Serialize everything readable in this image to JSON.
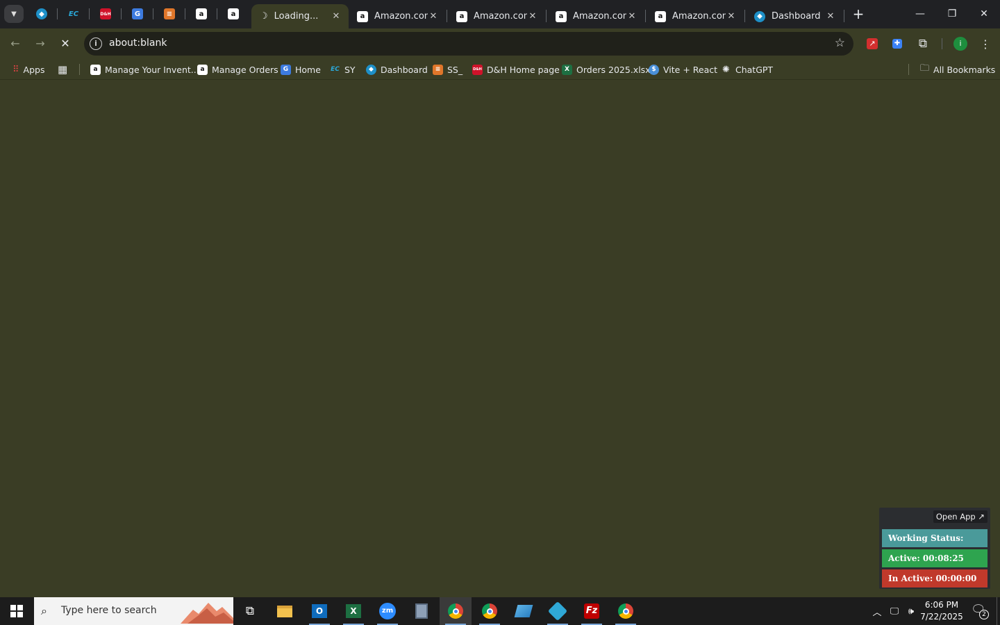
{
  "tabs": {
    "pinned": [
      {
        "icon": "dashboard-favicon",
        "color": "#4fa3e0",
        "glyph": "◆"
      },
      {
        "icon": "ec-favicon",
        "color": "#2aa8d8",
        "glyph": "EC"
      },
      {
        "icon": "dh-favicon",
        "color": "#d0122a",
        "glyph": "D&H"
      },
      {
        "icon": "google-docs-favicon",
        "color": "#3d7be0",
        "glyph": "G"
      },
      {
        "icon": "stack-favicon",
        "color": "#e0762a",
        "glyph": "≡"
      },
      {
        "icon": "amazon-favicon",
        "color": "#ffffff",
        "glyph": "a"
      },
      {
        "icon": "amazon-favicon",
        "color": "#ffffff",
        "glyph": "a"
      }
    ],
    "open": [
      {
        "title": "Loading...",
        "icon": "loading-spinner-icon",
        "active": true
      },
      {
        "title": "Amazon.com",
        "icon": "amazon-favicon",
        "active": false
      },
      {
        "title": "Amazon.com",
        "icon": "amazon-favicon",
        "active": false
      },
      {
        "title": "Amazon.com",
        "icon": "amazon-favicon",
        "active": false
      },
      {
        "title": "Amazon.com",
        "icon": "amazon-favicon",
        "active": false
      },
      {
        "title": "Dashboard",
        "icon": "dashboard-favicon",
        "active": false
      }
    ],
    "close_glyph": "✕",
    "new_tab_glyph": "+"
  },
  "window_controls": {
    "minimize": "—",
    "restore": "❐",
    "close": "✕"
  },
  "toolbar": {
    "url": "about:blank",
    "info_glyph": "i",
    "back_glyph": "←",
    "forward_glyph": "→",
    "stop_glyph": "✕",
    "star_glyph": "☆",
    "profile_initial": "i",
    "menu_glyph": "⋮"
  },
  "bookmarks": [
    {
      "label": "Apps",
      "icon": "apps-grid-icon"
    },
    {
      "label": "",
      "icon": "tab-groups-icon"
    },
    {
      "label": "Manage Your Invent...",
      "icon": "amazon-favicon"
    },
    {
      "label": "Manage Orders",
      "icon": "amazon-favicon"
    },
    {
      "label": "Home",
      "icon": "google-docs-favicon"
    },
    {
      "label": "SY",
      "icon": "ec-favicon"
    },
    {
      "label": "Dashboard",
      "icon": "dashboard-favicon"
    },
    {
      "label": "SS_",
      "icon": "stack-favicon"
    },
    {
      "label": "D&H Home page",
      "icon": "dh-favicon"
    },
    {
      "label": "Orders 2025.xlsx",
      "icon": "excel-favicon"
    },
    {
      "label": "Vite + React",
      "icon": "vite-favicon"
    },
    {
      "label": "ChatGPT",
      "icon": "chatgpt-favicon"
    },
    {
      "label": "All Bookmarks",
      "icon": "folder-icon"
    }
  ],
  "status_widget": {
    "open_app": "Open App ↗",
    "working_status": "Working Status: Active",
    "active": "Active: 00:08:25",
    "inactive": "In Active: 00:00:00",
    "colors": {
      "working": "#4a9a9a",
      "active": "#2ea44f",
      "inactive": "#c0392b"
    }
  },
  "taskbar": {
    "search_placeholder": "Type here to search",
    "apps": [
      "task-view-icon",
      "file-explorer-icon",
      "outlook-icon",
      "excel-icon",
      "zoom-icon",
      "calculator-icon",
      "chrome-icon",
      "chrome-icon",
      "maps-icon",
      "vscode-icon",
      "filezilla-icon",
      "chrome-profile-icon"
    ],
    "clock_time": "6:06 PM",
    "clock_date": "7/22/2025",
    "notification_count": "2"
  }
}
